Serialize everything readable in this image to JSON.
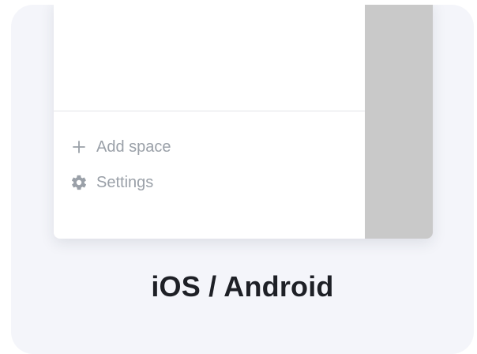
{
  "menu": {
    "add_space_label": "Add space",
    "settings_label": "Settings"
  },
  "icons": {
    "add": "plus-icon",
    "settings": "gear-icon"
  },
  "caption": "iOS / Android",
  "colors": {
    "card_background": "#f4f5fa",
    "panel_background": "#ffffff",
    "overlay": "#c9c9c9",
    "menu_text": "#9aa0a8",
    "caption_text": "#1e2026"
  }
}
